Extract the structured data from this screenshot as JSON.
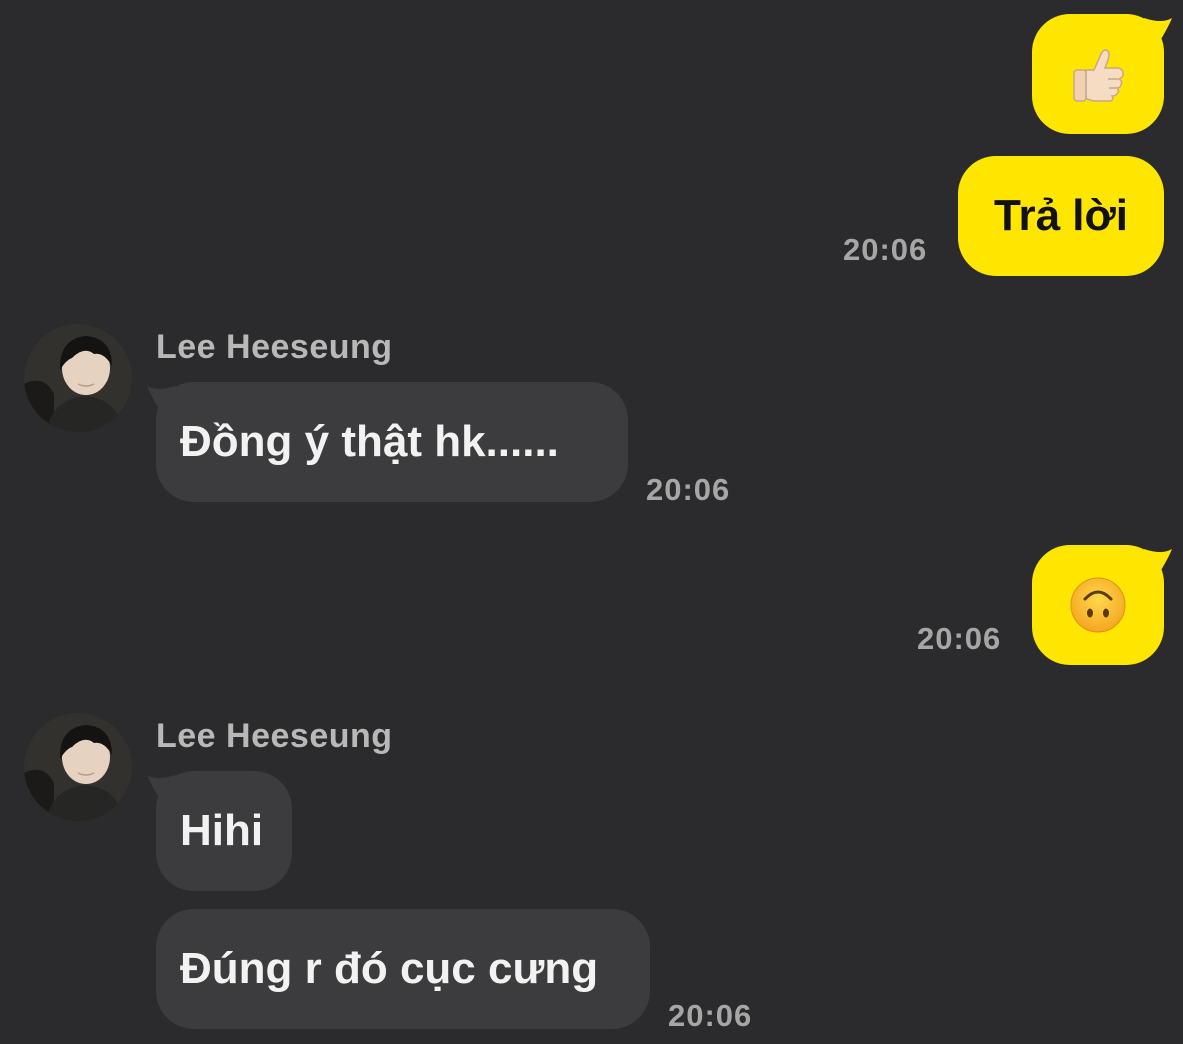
{
  "contact": {
    "name": "Lee Heeseung",
    "avatar_icon": "person-photo-avatar"
  },
  "colors": {
    "background": "#2b2b2d",
    "outgoing_bubble": "#ffe600",
    "incoming_bubble": "#3c3c3e",
    "timestamp": "#a6a6a6"
  },
  "messages": [
    {
      "from": "me",
      "type": "emoji",
      "icon": "thumbs-up-emoji",
      "time": ""
    },
    {
      "from": "me",
      "type": "text",
      "text": "Trả lời",
      "time": "20:06"
    },
    {
      "from": "them",
      "sender": "Lee Heeseung",
      "type": "text",
      "text": "Đồng ý thật hk......",
      "time": "20:06"
    },
    {
      "from": "me",
      "type": "emoji",
      "icon": "upside-down-face-emoji",
      "time": "20:06"
    },
    {
      "from": "them",
      "sender": "Lee Heeseung",
      "type": "text",
      "text": "Hihi",
      "time": ""
    },
    {
      "from": "them",
      "type": "text",
      "text": "Đúng r đó cục cưng",
      "time": "20:06"
    }
  ]
}
